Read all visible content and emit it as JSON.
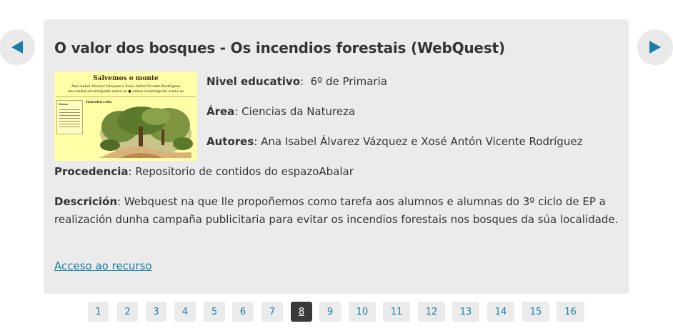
{
  "nav": {
    "prev_icon": "triangle-left-icon",
    "next_icon": "triangle-right-icon",
    "arrow_color": "#1a7fa8"
  },
  "card": {
    "title": "O valor dos bosques - Os incendios forestais (WebQuest)",
    "thumbnail": {
      "title": "Salvemos o monte",
      "authors_line1": "Ana Isabel Álvarez Vázquez e Xosé Antón Vicente Rodríguez",
      "authors_line2": "ana.isabel.alvarez@edu.xunta.es  ●  anton.vicente@edu.xunta.es",
      "menu_title": "Menu",
      "intro": "Introducción"
    },
    "level_label": "Nivel educativo",
    "level_value": "6º de Primaria",
    "area_label": "Área",
    "area_value": "Ciencias da Natureza",
    "authors_label": "Autores",
    "authors_value": "Ana Isabel Álvarez Vázquez e Xosé Antón Vicente Rodríguez",
    "source_label": "Procedencia",
    "source_value": "Repositorio de contidos do espazoAbalar",
    "desc_label": "Descrición",
    "desc_value": "Webquest na que lle propoñemos como tarefa aos alumnos e alumnas do 3º ciclo de EP a realización dunha campaña publicitaria para evitar os incendios forestais nos bosques da súa localidade.",
    "link_text": "Acceso ao recurso"
  },
  "pagination": {
    "pages": [
      "1",
      "2",
      "3",
      "4",
      "5",
      "6",
      "7",
      "8",
      "9",
      "10",
      "11",
      "12",
      "13",
      "14",
      "15",
      "16"
    ],
    "current": "8"
  }
}
